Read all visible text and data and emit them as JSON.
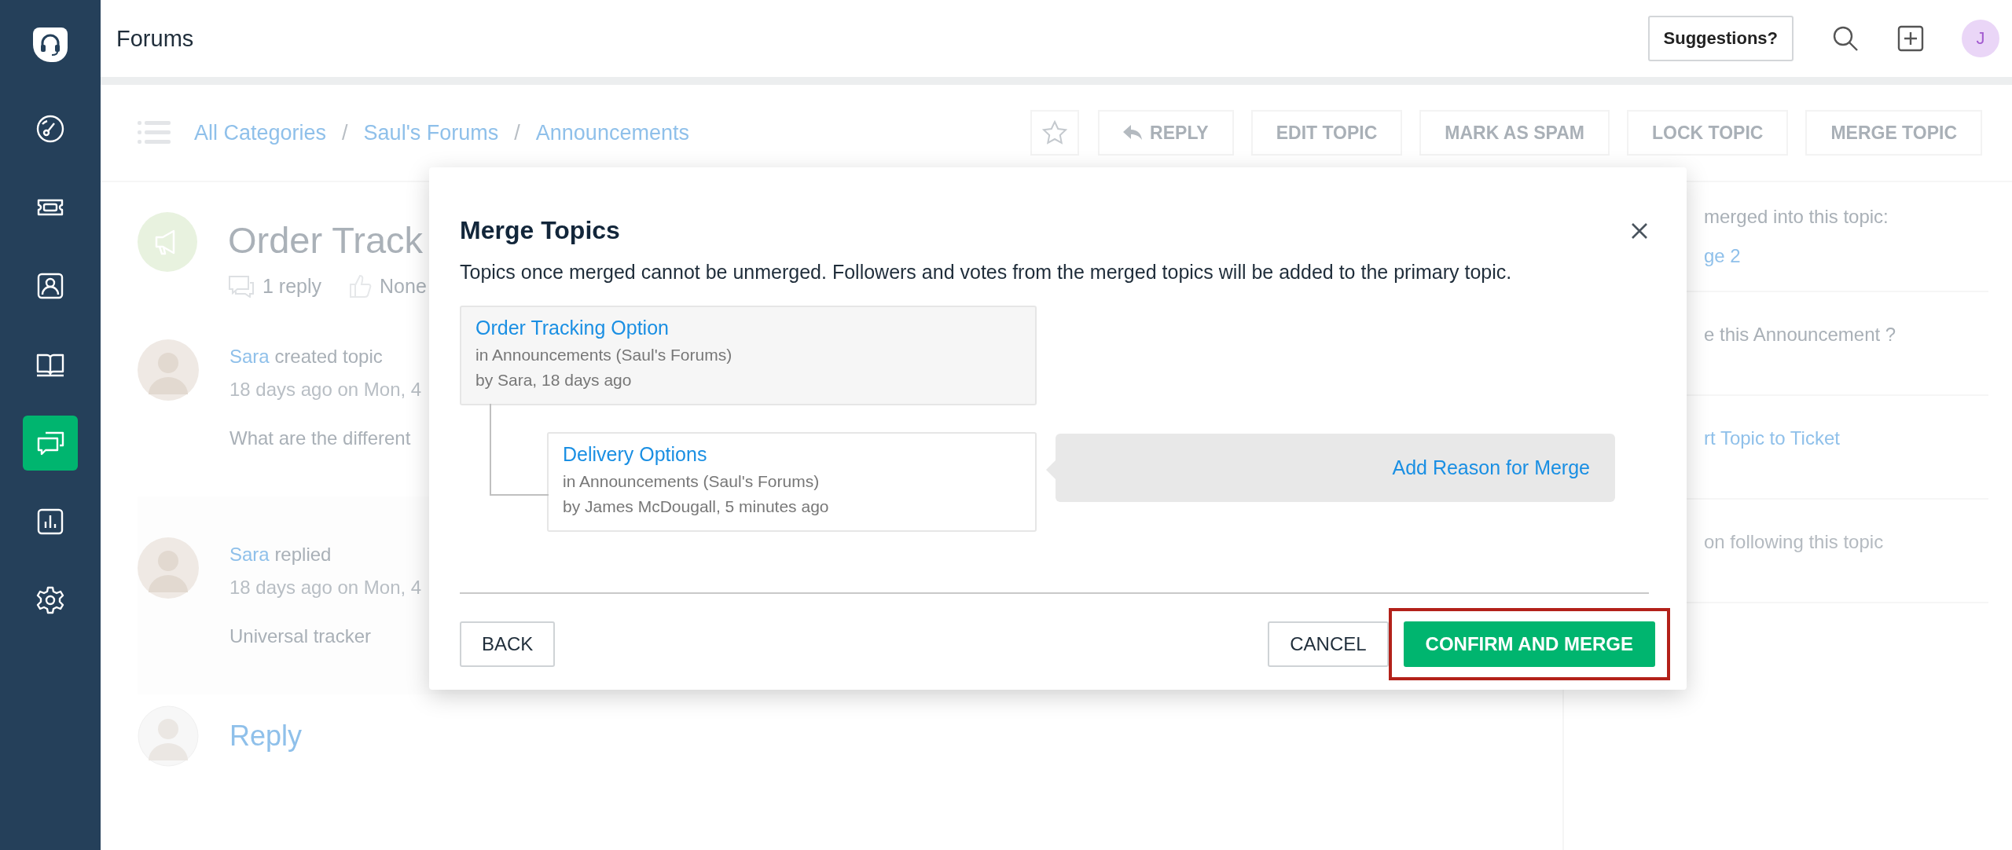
{
  "sidebar": {
    "items": [
      {
        "kind": "dashboard",
        "selected": false
      },
      {
        "kind": "tickets",
        "selected": false
      },
      {
        "kind": "contacts",
        "selected": false
      },
      {
        "kind": "solutions",
        "selected": false
      },
      {
        "kind": "forums",
        "selected": true
      },
      {
        "kind": "reports",
        "selected": false
      },
      {
        "kind": "settings",
        "selected": false
      }
    ]
  },
  "topbar": {
    "title": "Forums",
    "suggestions_button": "Suggestions?",
    "avatar_initial": "J"
  },
  "breadcrumb": {
    "items": [
      "All Categories",
      "Saul's Forums",
      "Announcements"
    ],
    "separator": "/"
  },
  "actions": [
    {
      "label": "REPLY",
      "kind": "reply"
    },
    {
      "label": "EDIT TOPIC",
      "kind": "plain"
    },
    {
      "label": "MARK AS SPAM",
      "kind": "plain"
    },
    {
      "label": "LOCK TOPIC",
      "kind": "plain"
    },
    {
      "label": "MERGE TOPIC",
      "kind": "plain"
    }
  ],
  "topic": {
    "title": "Order Track",
    "replies": "1 reply",
    "votes": "None"
  },
  "posts": [
    {
      "author": "Sara",
      "action": "created topic",
      "time": "18 days ago on Mon, 4",
      "body": "What are the different"
    },
    {
      "author": "Sara",
      "action": "replied",
      "time": "18 days ago on Mon, 4",
      "body": "Universal tracker"
    }
  ],
  "reply_prompt": "Reply",
  "side_panel": [
    [
      {
        "text": "merged into this topic:",
        "kind": "text"
      },
      {
        "text": "ge 2",
        "kind": "link"
      }
    ],
    [
      {
        "text": "e this Announcement ?",
        "kind": "text"
      }
    ],
    [
      {
        "text": "rt Topic to Ticket",
        "kind": "link"
      }
    ],
    [
      {
        "text": "on following this topic",
        "kind": "muted"
      }
    ]
  ],
  "modal": {
    "title": "Merge Topics",
    "description": "Topics once merged cannot be unmerged. Followers and votes from the merged topics will be added to the primary topic.",
    "primary": {
      "title": "Order Tracking Option",
      "location": "in Announcements (Saul's Forums)",
      "byline": "by Sara, 18 days ago"
    },
    "merged": {
      "title": "Delivery Options",
      "location": "in Announcements (Saul's Forums)",
      "byline": "by James McDougall, 5 minutes ago"
    },
    "reason_link": "Add Reason for Merge",
    "back_button": "BACK",
    "cancel_button": "CANCEL",
    "confirm_button": "CONFIRM AND MERGE",
    "confirm_highlighted": true
  }
}
